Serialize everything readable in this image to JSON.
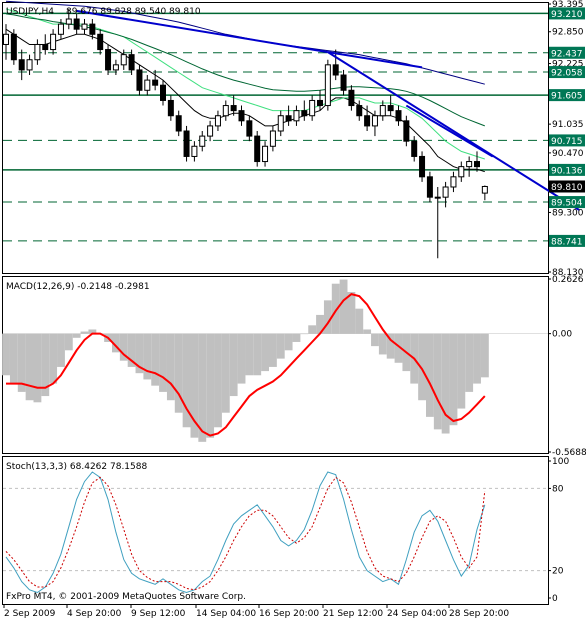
{
  "chart_data": [
    {
      "type": "candlestick",
      "title": "USDJPY,H4",
      "ohlc_label": "89.676 89.828 89.540 89.810",
      "ylim": [
        88.13,
        93.395
      ],
      "y_ticks": [
        "93.395",
        "92.850",
        "92.437",
        "92.225",
        "92.058",
        "91.605",
        "91.035",
        "90.715",
        "90.470",
        "90.136",
        "89.810",
        "89.504",
        "89.300",
        "88.741",
        "88.130"
      ],
      "levels_solid": [
        {
          "value": 93.21,
          "label": "93.210"
        },
        {
          "value": 91.605,
          "label": "91.605"
        },
        {
          "value": 90.136,
          "label": "90.136"
        }
      ],
      "levels_dashed": [
        {
          "value": 92.437,
          "label": "92.437"
        },
        {
          "value": 92.058,
          "label": "92.058"
        },
        {
          "value": 90.715,
          "label": "90.715"
        },
        {
          "value": 89.504,
          "label": "89.504"
        },
        {
          "value": 88.741,
          "label": "88.741"
        }
      ],
      "current_price": {
        "value": 89.81,
        "label": "89.810"
      },
      "series": [
        {
          "kind": "candles",
          "bars": [
            [
              92.6,
              93.0,
              92.3,
              92.8
            ],
            [
              92.8,
              92.9,
              92.2,
              92.3
            ],
            [
              92.3,
              92.5,
              91.9,
              92.1
            ],
            [
              92.1,
              92.4,
              92.0,
              92.3
            ],
            [
              92.3,
              92.7,
              92.2,
              92.6
            ],
            [
              92.6,
              92.8,
              92.4,
              92.5
            ],
            [
              92.5,
              92.9,
              92.4,
              92.8
            ],
            [
              92.8,
              93.1,
              92.7,
              93.0
            ],
            [
              93.0,
              93.3,
              92.9,
              93.1
            ],
            [
              93.1,
              93.2,
              92.8,
              92.9
            ],
            [
              92.9,
              93.1,
              92.8,
              93.0
            ],
            [
              93.0,
              93.1,
              92.7,
              92.8
            ],
            [
              92.8,
              92.9,
              92.4,
              92.5
            ],
            [
              92.5,
              92.6,
              92.0,
              92.1
            ],
            [
              92.1,
              92.3,
              92.0,
              92.2
            ],
            [
              92.2,
              92.5,
              92.1,
              92.4
            ],
            [
              92.4,
              92.5,
              92.0,
              92.1
            ],
            [
              92.1,
              92.2,
              91.6,
              91.7
            ],
            [
              91.7,
              92.0,
              91.6,
              91.9
            ],
            [
              91.9,
              92.1,
              91.7,
              91.8
            ],
            [
              91.8,
              91.9,
              91.4,
              91.5
            ],
            [
              91.5,
              91.6,
              91.1,
              91.2
            ],
            [
              91.2,
              91.3,
              90.8,
              90.9
            ],
            [
              90.9,
              91.0,
              90.3,
              90.4
            ],
            [
              90.4,
              90.7,
              90.3,
              90.6
            ],
            [
              90.6,
              90.9,
              90.5,
              90.8
            ],
            [
              90.8,
              91.1,
              90.7,
              91.0
            ],
            [
              91.0,
              91.3,
              90.9,
              91.2
            ],
            [
              91.2,
              91.5,
              91.1,
              91.4
            ],
            [
              91.4,
              91.6,
              91.2,
              91.3
            ],
            [
              91.3,
              91.4,
              91.0,
              91.1
            ],
            [
              91.1,
              91.2,
              90.7,
              90.8
            ],
            [
              90.8,
              90.9,
              90.2,
              90.3
            ],
            [
              90.3,
              90.7,
              90.2,
              90.6
            ],
            [
              90.6,
              91.0,
              90.5,
              90.9
            ],
            [
              90.9,
              91.3,
              90.8,
              91.2
            ],
            [
              91.2,
              91.4,
              91.0,
              91.1
            ],
            [
              91.1,
              91.4,
              91.0,
              91.3
            ],
            [
              91.3,
              91.5,
              91.1,
              91.2
            ],
            [
              91.2,
              91.6,
              91.1,
              91.5
            ],
            [
              91.5,
              91.7,
              91.3,
              91.4
            ],
            [
              91.4,
              92.3,
              91.3,
              92.2
            ],
            [
              92.2,
              92.5,
              91.9,
              92.0
            ],
            [
              92.0,
              92.1,
              91.6,
              91.7
            ],
            [
              91.7,
              91.8,
              91.3,
              91.4
            ],
            [
              91.4,
              91.5,
              91.1,
              91.2
            ],
            [
              91.2,
              91.4,
              90.9,
              91.0
            ],
            [
              91.0,
              91.3,
              90.8,
              91.2
            ],
            [
              91.2,
              91.5,
              91.1,
              91.4
            ],
            [
              91.4,
              91.6,
              91.2,
              91.3
            ],
            [
              91.3,
              91.4,
              91.0,
              91.1
            ],
            [
              91.1,
              91.2,
              90.6,
              90.7
            ],
            [
              90.7,
              90.8,
              90.3,
              90.4
            ],
            [
              90.4,
              90.5,
              89.9,
              90.0
            ],
            [
              90.0,
              90.1,
              89.5,
              89.6
            ],
            [
              89.6,
              89.8,
              88.4,
              89.6
            ],
            [
              89.6,
              89.9,
              89.4,
              89.8
            ],
            [
              89.8,
              90.1,
              89.7,
              90.0
            ],
            [
              90.0,
              90.3,
              89.9,
              90.2
            ],
            [
              90.2,
              90.4,
              90.0,
              90.3
            ],
            [
              90.3,
              90.5,
              90.1,
              90.2
            ],
            [
              89.68,
              89.83,
              89.54,
              89.81
            ]
          ]
        },
        {
          "kind": "line",
          "name": "MA black",
          "color": "#000000",
          "values": [
            92.9,
            92.8,
            92.7,
            92.6,
            92.6,
            92.6,
            92.65,
            92.7,
            92.75,
            92.8,
            92.8,
            92.75,
            92.7,
            92.6,
            92.5,
            92.4,
            92.3,
            92.2,
            92.1,
            92.0,
            91.9,
            91.75,
            91.6,
            91.45,
            91.3,
            91.2,
            91.15,
            91.15,
            91.2,
            91.25,
            91.25,
            91.2,
            91.1,
            91.0,
            91.0,
            91.05,
            91.1,
            91.15,
            91.2,
            91.25,
            91.3,
            91.45,
            91.55,
            91.55,
            91.5,
            91.4,
            91.3,
            91.2,
            91.2,
            91.2,
            91.15,
            91.05,
            90.9,
            90.75,
            90.6,
            90.4,
            90.3,
            90.2,
            90.15,
            90.15,
            90.15,
            90.1
          ]
        },
        {
          "kind": "line",
          "name": "MA green",
          "color": "#40e080",
          "values": [
            93.3,
            93.25,
            93.2,
            93.15,
            93.1,
            93.05,
            93.0,
            93.0,
            93.0,
            93.0,
            93.0,
            92.95,
            92.9,
            92.85,
            92.8,
            92.75,
            92.65,
            92.55,
            92.45,
            92.35,
            92.25,
            92.15,
            92.05,
            91.95,
            91.85,
            91.75,
            91.7,
            91.65,
            91.6,
            91.55,
            91.5,
            91.45,
            91.4,
            91.35,
            91.3,
            91.3,
            91.3,
            91.3,
            91.3,
            91.35,
            91.4,
            91.45,
            91.5,
            91.55,
            91.55,
            91.55,
            91.5,
            91.45,
            91.45,
            91.45,
            91.4,
            91.35,
            91.25,
            91.15,
            91.0,
            90.85,
            90.7,
            90.6,
            90.5,
            90.45,
            90.4,
            90.35
          ]
        },
        {
          "kind": "line",
          "name": "MA dark green",
          "color": "#006633",
          "values": [
            93.2,
            93.18,
            93.15,
            93.12,
            93.1,
            93.08,
            93.05,
            93.03,
            93.0,
            92.98,
            92.95,
            92.92,
            92.88,
            92.84,
            92.8,
            92.75,
            92.7,
            92.64,
            92.58,
            92.52,
            92.46,
            92.4,
            92.33,
            92.26,
            92.19,
            92.12,
            92.06,
            92.0,
            91.95,
            91.9,
            91.86,
            91.82,
            91.78,
            91.74,
            91.71,
            91.7,
            91.69,
            91.68,
            91.68,
            91.69,
            91.7,
            91.72,
            91.74,
            91.76,
            91.77,
            91.77,
            91.76,
            91.75,
            91.74,
            91.73,
            91.71,
            91.68,
            91.63,
            91.57,
            91.5,
            91.42,
            91.34,
            91.26,
            91.18,
            91.12,
            91.06,
            91.0
          ]
        },
        {
          "kind": "line",
          "name": "MA navy",
          "color": "#000080",
          "values": [
            93.45,
            93.44,
            93.43,
            93.42,
            93.41,
            93.4,
            93.39,
            93.38,
            93.37,
            93.36,
            93.35,
            93.33,
            93.31,
            93.29,
            93.27,
            93.25,
            93.22,
            93.19,
            93.16,
            93.13,
            93.1,
            93.07,
            93.04,
            93.0,
            92.96,
            92.92,
            92.88,
            92.84,
            92.8,
            92.77,
            92.74,
            92.71,
            92.68,
            92.65,
            92.62,
            92.6,
            92.58,
            92.56,
            92.54,
            92.52,
            92.5,
            92.48,
            92.46,
            92.44,
            92.42,
            92.4,
            92.37,
            92.34,
            92.31,
            92.28,
            92.25,
            92.22,
            92.18,
            92.14,
            92.1,
            92.06,
            92.02,
            91.98,
            91.94,
            91.9,
            91.86,
            91.82
          ]
        }
      ],
      "trendlines": [
        {
          "color": "#0000cc",
          "points": [
            [
              9,
              93.26
            ],
            [
              41,
              92.45
            ]
          ]
        },
        {
          "color": "#0000cc",
          "points": [
            [
              41,
              92.45
            ],
            [
              53,
              92.15
            ]
          ]
        },
        {
          "color": "#0000cc",
          "points": [
            [
              41,
              92.45
            ],
            [
              73,
              89.35
            ]
          ]
        },
        {
          "color": "#0000cc",
          "points": [
            [
              51,
              91.4
            ],
            [
              62,
              90.4
            ]
          ]
        }
      ]
    },
    {
      "type": "bar",
      "title": "MACD(12,26,9) -0.2148 -0.2981",
      "ylim": [
        -0.5688,
        0.2626
      ],
      "y_ticks": [
        "0.2626",
        "0.00",
        "-0.5688"
      ],
      "series": [
        {
          "name": "MACD",
          "kind": "histogram",
          "color": "#c0c0c0",
          "values": [
            -0.2,
            -0.24,
            -0.28,
            -0.32,
            -0.33,
            -0.3,
            -0.24,
            -0.16,
            -0.08,
            -0.02,
            0.01,
            0.02,
            0.0,
            -0.04,
            -0.09,
            -0.13,
            -0.16,
            -0.19,
            -0.22,
            -0.25,
            -0.28,
            -0.32,
            -0.38,
            -0.45,
            -0.5,
            -0.52,
            -0.5,
            -0.45,
            -0.38,
            -0.3,
            -0.24,
            -0.2,
            -0.2,
            -0.18,
            -0.16,
            -0.12,
            -0.08,
            -0.04,
            0.0,
            0.04,
            0.09,
            0.16,
            0.24,
            0.26,
            0.2,
            0.12,
            0.02,
            -0.06,
            -0.1,
            -0.12,
            -0.14,
            -0.18,
            -0.24,
            -0.32,
            -0.4,
            -0.46,
            -0.48,
            -0.44,
            -0.36,
            -0.28,
            -0.24,
            -0.21
          ]
        },
        {
          "name": "Signal",
          "kind": "line",
          "color": "#ff0000",
          "values": [
            -0.24,
            -0.24,
            -0.24,
            -0.25,
            -0.26,
            -0.26,
            -0.24,
            -0.2,
            -0.14,
            -0.08,
            -0.03,
            0.0,
            0.0,
            -0.02,
            -0.06,
            -0.1,
            -0.13,
            -0.16,
            -0.18,
            -0.19,
            -0.21,
            -0.24,
            -0.29,
            -0.36,
            -0.42,
            -0.47,
            -0.49,
            -0.48,
            -0.45,
            -0.4,
            -0.35,
            -0.3,
            -0.27,
            -0.25,
            -0.23,
            -0.2,
            -0.16,
            -0.12,
            -0.08,
            -0.04,
            0.0,
            0.05,
            0.11,
            0.16,
            0.19,
            0.18,
            0.14,
            0.08,
            0.02,
            -0.03,
            -0.06,
            -0.09,
            -0.12,
            -0.17,
            -0.24,
            -0.32,
            -0.39,
            -0.42,
            -0.41,
            -0.38,
            -0.34,
            -0.3
          ]
        }
      ]
    },
    {
      "type": "line",
      "title": "Stoch(13,3,3) 68.4262 78.1588",
      "ylim": [
        0,
        100
      ],
      "y_ticks": [
        "100",
        "80",
        "20",
        "0"
      ],
      "levels": [
        80,
        20
      ],
      "series": [
        {
          "name": "%K",
          "color": "#40a0c0",
          "values": [
            30,
            22,
            12,
            6,
            4,
            8,
            18,
            32,
            52,
            72,
            85,
            92,
            88,
            72,
            48,
            28,
            18,
            14,
            12,
            10,
            14,
            10,
            6,
            4,
            6,
            12,
            16,
            28,
            42,
            54,
            60,
            64,
            68,
            60,
            52,
            42,
            38,
            42,
            50,
            64,
            82,
            92,
            90,
            72,
            50,
            30,
            20,
            16,
            12,
            14,
            10,
            28,
            48,
            60,
            64,
            56,
            42,
            28,
            16,
            24,
            50,
            68
          ]
        },
        {
          "name": "%D",
          "color": "#cc0000",
          "values": [
            34,
            28,
            20,
            12,
            8,
            8,
            12,
            22,
            36,
            52,
            70,
            84,
            88,
            82,
            68,
            50,
            32,
            20,
            15,
            12,
            12,
            12,
            10,
            7,
            6,
            8,
            12,
            20,
            30,
            42,
            52,
            60,
            64,
            64,
            60,
            52,
            44,
            40,
            44,
            52,
            66,
            80,
            88,
            84,
            70,
            52,
            34,
            22,
            16,
            14,
            12,
            18,
            30,
            44,
            56,
            60,
            56,
            44,
            30,
            22,
            30,
            78
          ]
        }
      ]
    }
  ],
  "x_labels": [
    "2 Sep 2009",
    "4 Sep 20:00",
    "9 Sep 12:00",
    "14 Sep 04:00",
    "16 Sep 20:00",
    "21 Sep 12:00",
    "24 Sep 04:00",
    "28 Sep 20:00"
  ],
  "footer": "FxPro MT4, © 2001-2009 MetaQuotes Software Corp.",
  "colors": {
    "up": "#000000",
    "down": "#000000",
    "level_line": "#006633",
    "trend": "#0000cc"
  }
}
